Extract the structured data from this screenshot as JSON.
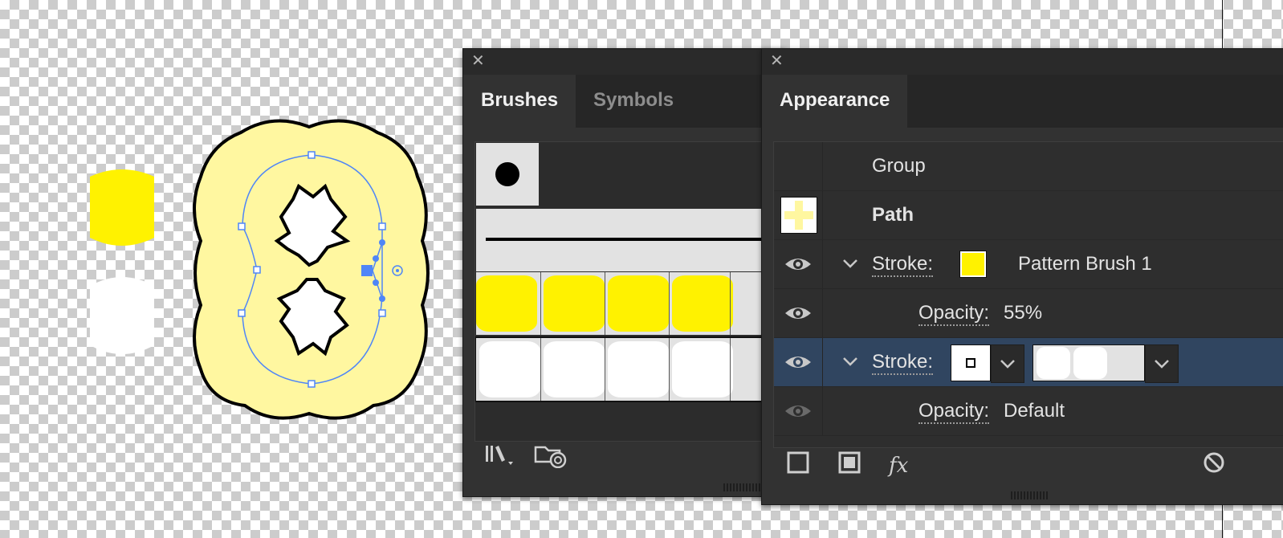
{
  "brushes_panel": {
    "tabs": [
      {
        "label": "Brushes",
        "active": true
      },
      {
        "label": "Symbols",
        "active": false
      }
    ],
    "close_icon": "close-icon",
    "footer_icons": [
      "brush-libraries-icon",
      "cc-libraries-icon"
    ]
  },
  "appearance_panel": {
    "tab": "Appearance",
    "rows": {
      "group": {
        "label": "Group"
      },
      "path": {
        "label": "Path"
      },
      "stroke1": {
        "label": "Stroke:",
        "brush": "Pattern Brush 1",
        "color": "#fff200"
      },
      "opacity1": {
        "label": "Opacity:",
        "value": "55%"
      },
      "stroke2": {
        "label": "Stroke:"
      },
      "opacity2": {
        "label": "Opacity:",
        "value": "Default"
      }
    },
    "footer_icons": [
      "add-stroke-icon",
      "add-fill-icon",
      "fx-icon",
      "clear-appearance-icon"
    ],
    "fx_label": "fx"
  },
  "colors": {
    "panel_bg": "#323232",
    "selection": "#304560",
    "brush_yellow": "#fff200",
    "shape_fill": "#fff7a0"
  }
}
